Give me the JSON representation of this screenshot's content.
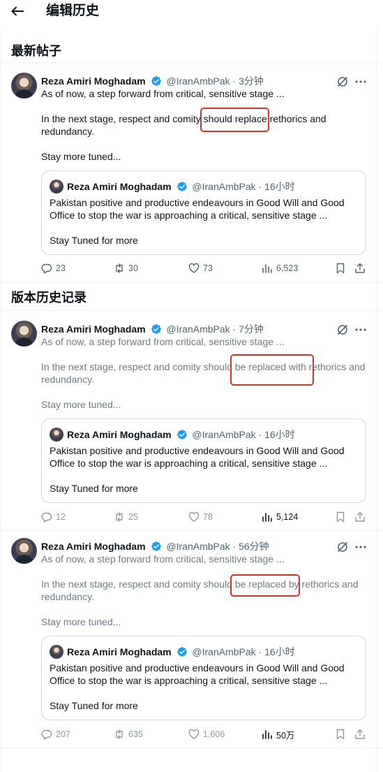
{
  "header": {
    "title": "编辑历史"
  },
  "sections": {
    "latest": "最新帖子",
    "history": "版本历史记录"
  },
  "posts": [
    {
      "author": "Reza Amiri Moghadam",
      "handle": "@IranAmbPak",
      "dot": "·",
      "time": "3分钟",
      "line1": "As of now, a step forward from critical, sensitive stage ...",
      "line2": "In the next stage, respect and comity should replace rethorics and redundancy.",
      "line3": "Stay more tuned...",
      "quote": {
        "author": "Reza Amiri Moghadam",
        "handle": "@IranAmbPak",
        "dot": "·",
        "time": "16小时",
        "text": "Pakistan positive and productive endeavours in Good Will and Good Office to stop the war is approaching a critical, sensitive stage ...",
        "more": "Stay Tuned for more"
      },
      "replies": "23",
      "reposts": "30",
      "likes": "73",
      "views": "6,523"
    },
    {
      "author": "Reza Amiri Moghadam",
      "handle": "@IranAmbPak",
      "dot": "·",
      "time": "7分钟",
      "line1": "As of now, a step forward from critical, sensitive stage ...",
      "line2": "In the next stage, respect and comity should be replaced with rethorics and redundancy.",
      "line3": "Stay more tuned...",
      "quote": {
        "author": "Reza Amiri Moghadam",
        "handle": "@IranAmbPak",
        "dot": "·",
        "time": "16小时",
        "text": "Pakistan positive and productive endeavours in Good Will and Good Office to stop the war is approaching a critical, sensitive stage ...",
        "more": "Stay Tuned for more"
      },
      "replies": "12",
      "reposts": "25",
      "likes": "78",
      "views": "5,124"
    },
    {
      "author": "Reza Amiri Moghadam",
      "handle": "@IranAmbPak",
      "dot": "·",
      "time": "56分钟",
      "line1": "As of now, a step forward from critical, sensitive stage ...",
      "line2": "In the next stage, respect and comity should be replaced by rethorics and redundancy.",
      "line3": "Stay more tuned...",
      "quote": {
        "author": "Reza Amiri Moghadam",
        "handle": "@IranAmbPak",
        "dot": "·",
        "time": "16小时",
        "text": "Pakistan positive and productive endeavours in Good Will and Good Office to stop the war is approaching a critical, sensitive stage ...",
        "more": "Stay Tuned for more"
      },
      "replies": "207",
      "reposts": "635",
      "likes": "1,606",
      "views": "50万"
    }
  ],
  "colors": {
    "verified": "#1d9bf0",
    "highlight": "#c8372d",
    "muted": "#536471",
    "border": "#cfd9de"
  }
}
